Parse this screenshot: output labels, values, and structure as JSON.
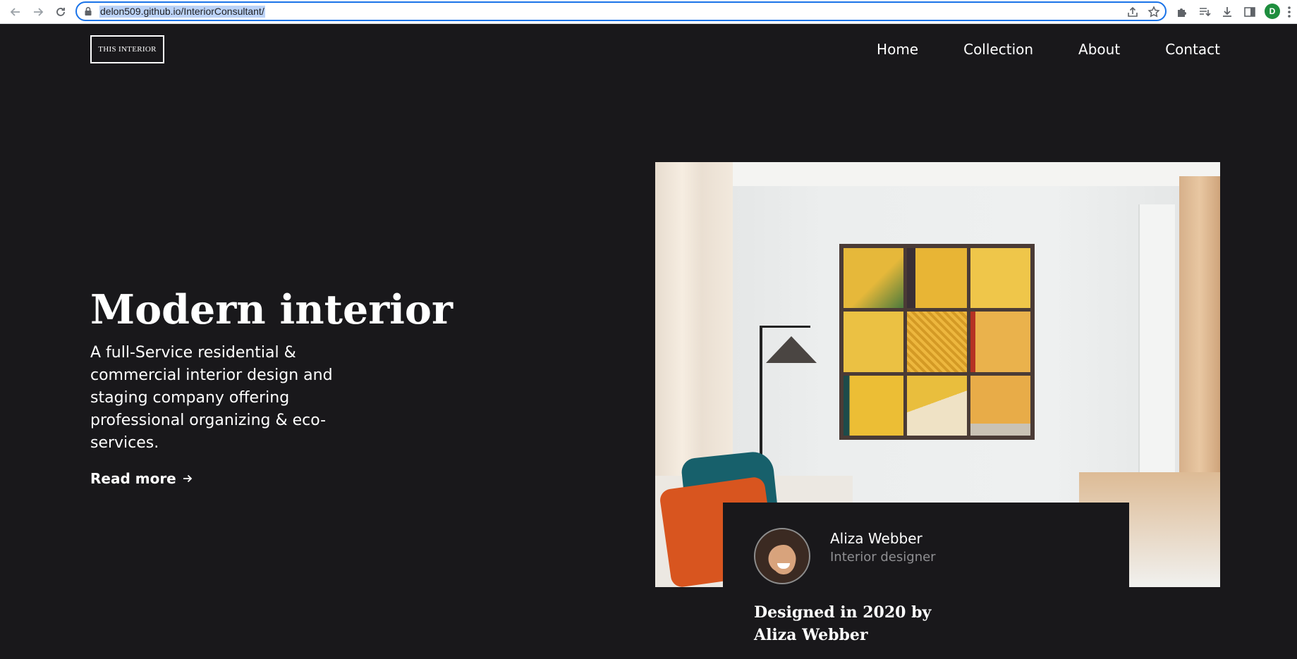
{
  "browser": {
    "url": "delon509.github.io/InteriorConsultant/",
    "profile_initial": "D"
  },
  "header": {
    "logo_text": "THIS INTERIOR",
    "nav": [
      "Home",
      "Collection",
      "About",
      "Contact"
    ]
  },
  "hero": {
    "title": "Modern interior",
    "description": "A full-Service residential & commercial interior design and staging company offering professional organizing & eco-services.",
    "cta_label": "Read more"
  },
  "designer": {
    "name": "Aliza Webber",
    "role": "Interior designer",
    "caption": "Designed in 2020 by Aliza Webber"
  },
  "colors": {
    "background": "#19181b",
    "text": "#ffffff",
    "muted": "#8f8f92",
    "focus_ring": "#1a73e8"
  }
}
